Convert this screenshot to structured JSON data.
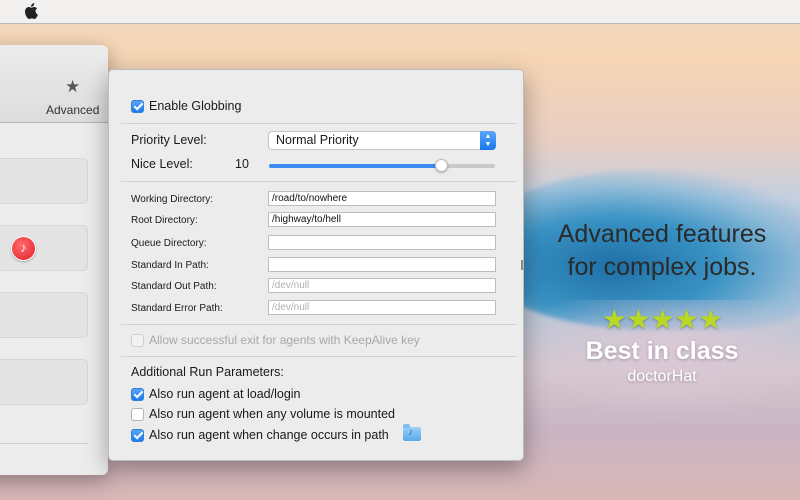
{
  "back_window": {
    "toolbar_label": "Advanced"
  },
  "panel": {
    "enable_globbing": {
      "label": "Enable Globbing",
      "checked": true
    },
    "priority_level": {
      "label": "Priority Level:",
      "value": "Normal Priority"
    },
    "nice_level": {
      "label": "Nice Level:",
      "value": "10",
      "slider_fraction": 0.76
    },
    "fields": {
      "working_directory": {
        "label": "Working Directory:",
        "value": "/road/to/nowhere",
        "placeholder": ""
      },
      "root_directory": {
        "label": "Root Directory:",
        "value": "/highway/to/hell",
        "placeholder": ""
      },
      "queue_directory": {
        "label": "Queue Directory:",
        "value": "",
        "placeholder": ""
      },
      "standard_in_path": {
        "label": "Standard In Path:",
        "value": "",
        "placeholder": ""
      },
      "standard_out_path": {
        "label": "Standard Out Path:",
        "value": "",
        "placeholder": "/dev/null"
      },
      "standard_error_path": {
        "label": "Standard Error Path:",
        "value": "",
        "placeholder": "/dev/null"
      }
    },
    "keepalive": {
      "label": "Allow successful exit for agents with KeepAlive key",
      "checked": false,
      "disabled": true
    },
    "additional_heading": "Additional Run Parameters:",
    "run_options": [
      {
        "label": "Also run agent at load/login",
        "checked": true
      },
      {
        "label": "Also run agent when any volume is mounted",
        "checked": false
      },
      {
        "label": "Also run agent when change occurs in path",
        "checked": true
      }
    ]
  },
  "promo": {
    "line1": "Advanced features",
    "line2": "for complex jobs.",
    "stars": "★★★★★",
    "rating": 5,
    "tagline": "Best in class",
    "brand": "doctorHat"
  },
  "colors": {
    "accent": "#1a7cf0",
    "stars": "#b9d824"
  }
}
